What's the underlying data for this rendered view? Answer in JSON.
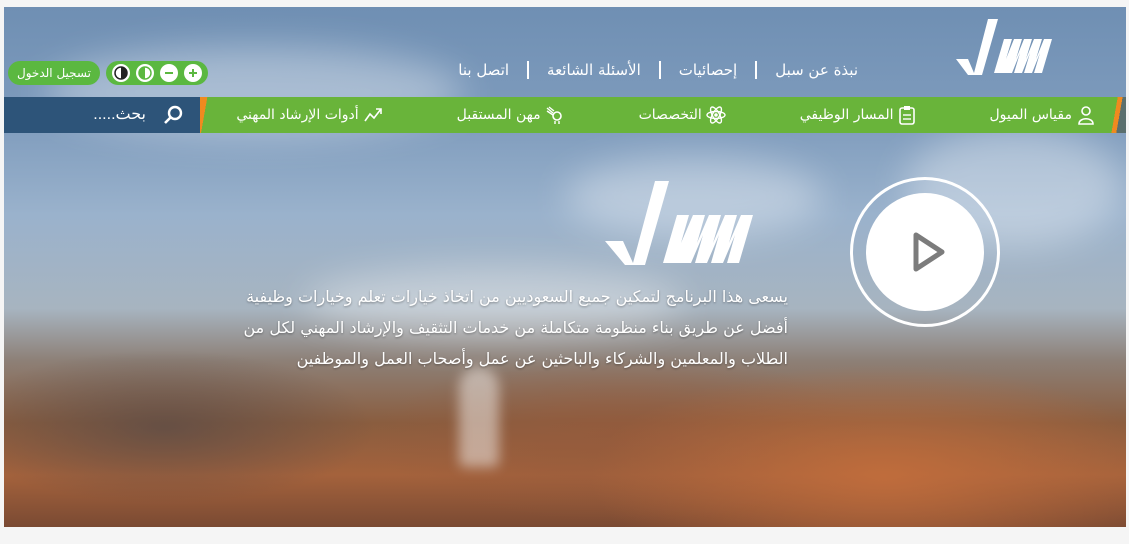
{
  "header": {
    "logo_icon": "sabil-logo",
    "links": [
      "نبذة عن سبل",
      "إحصائيات",
      "الأسئلة الشائعة",
      "اتصل بنا"
    ],
    "login_label": "تسجيل الدخول",
    "accessibility_icons": [
      "zoom-in-icon",
      "zoom-out-icon",
      "contrast-icon",
      "contrast-invert-icon"
    ]
  },
  "nav": {
    "items": [
      {
        "label": "مقياس الميول",
        "icon": "person-icon"
      },
      {
        "label": "المسار الوظيفي",
        "icon": "clipboard-icon"
      },
      {
        "label": "التخصصات",
        "icon": "atom-icon"
      },
      {
        "label": "مهن المستقبل",
        "icon": "robot-hand-icon"
      },
      {
        "label": "أدوات الإرشاد المهني",
        "icon": "trend-icon"
      }
    ],
    "search_placeholder": "بحث.....",
    "colors": {
      "nav": "#69b43a",
      "search": "#2d5479",
      "accent": "#f08a1f"
    }
  },
  "hero": {
    "logo_icon": "sabil-logo",
    "lines": [
      "يسعى هذا البرنامج لتمكين جميع السعوديين من اتخاذ خيارات تعلم وخيارات وظيفية",
      "أفضل عن طريق بناء منظومة متكاملة من خدمات التثقيف والإرشاد المهني لكل من",
      "الطلاب والمعلمين والشركاء والباحثين عن عمل وأصحاب العمل والموظفين"
    ],
    "play_icon": "play-icon"
  }
}
